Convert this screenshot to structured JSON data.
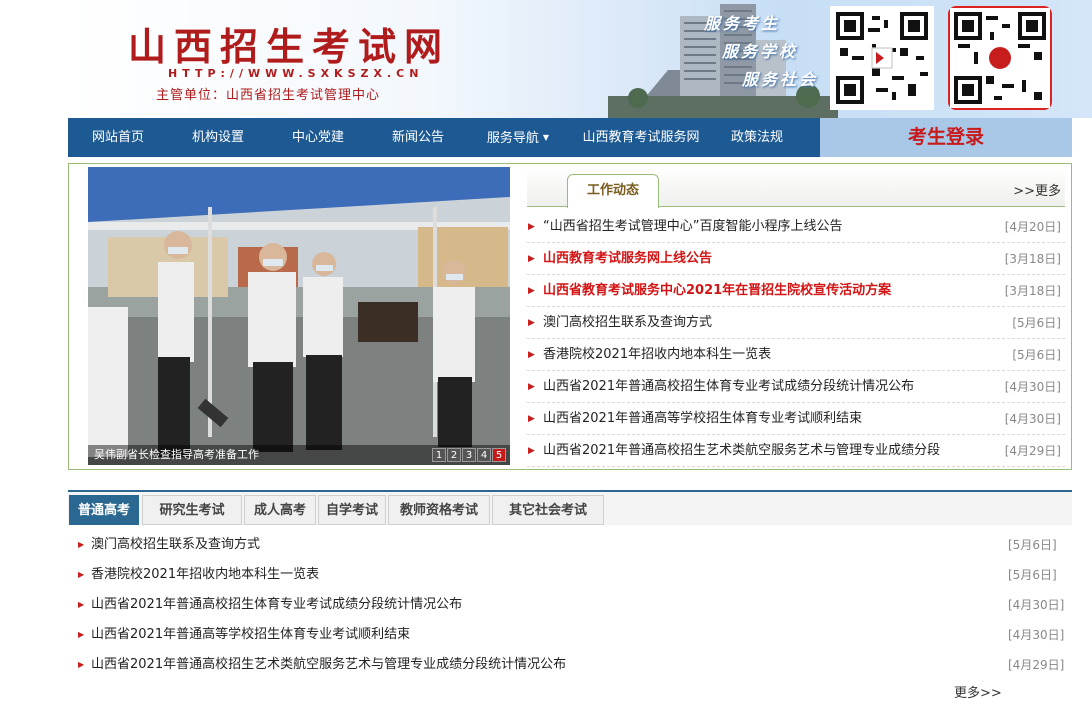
{
  "header": {
    "site_title": "山西招生考试网",
    "site_url": "HTTP://WWW.SXKSZX.CN",
    "dept": "主管单位：山西省招生考试管理中心",
    "slogans": [
      "服务考生",
      "服务学校",
      "服务社会"
    ]
  },
  "nav": {
    "items": [
      {
        "label": "网站首页"
      },
      {
        "label": "机构设置"
      },
      {
        "label": "中心党建"
      },
      {
        "label": "新闻公告"
      },
      {
        "label": "服务导航"
      },
      {
        "label": "山西教育考试服务网"
      },
      {
        "label": "政策法规"
      }
    ],
    "login": "考生登录"
  },
  "slideshow": {
    "caption": "吴伟副省长检查指导高考准备工作",
    "pages": [
      "1",
      "2",
      "3",
      "4",
      "5"
    ],
    "active_page": 5
  },
  "work_news": {
    "tab_label": "工作动态",
    "more": ">>更多",
    "items": [
      {
        "title": "“山西省招生考试管理中心”百度智能小程序上线公告",
        "date": "[4月20日]",
        "hot": false
      },
      {
        "title": "山西教育考试服务网上线公告",
        "date": "[3月18日]",
        "hot": true
      },
      {
        "title": "山西省教育考试服务中心2021年在晋招生院校宣传活动方案",
        "date": "[3月18日]",
        "hot": true
      },
      {
        "title": "澳门高校招生联系及查询方式",
        "date": "[5月6日]",
        "hot": false
      },
      {
        "title": "香港院校2021年招收内地本科生一览表",
        "date": "[5月6日]",
        "hot": false
      },
      {
        "title": "山西省2021年普通高校招生体育专业考试成绩分段统计情况公布",
        "date": "[4月30日]",
        "hot": false
      },
      {
        "title": "山西省2021年普通高等学校招生体育专业考试顺利结束",
        "date": "[4月30日]",
        "hot": false
      },
      {
        "title": "山西省2021年普通高校招生艺术类航空服务艺术与管理专业成绩分段",
        "date": "[4月29日]",
        "hot": false
      }
    ]
  },
  "exam_tabs": {
    "tabs": [
      "普通高考",
      "研究生考试",
      "成人高考",
      "自学考试",
      "教师资格考试",
      "其它社会考试"
    ],
    "active": 0,
    "items": [
      {
        "title": "澳门高校招生联系及查询方式",
        "date": "[5月6日]"
      },
      {
        "title": "香港院校2021年招收内地本科生一览表",
        "date": "[5月6日]"
      },
      {
        "title": "山西省2021年普通高校招生体育专业考试成绩分段统计情况公布",
        "date": "[4月30日]"
      },
      {
        "title": "山西省2021年普通高等学校招生体育专业考试顺利结束",
        "date": "[4月30日]"
      },
      {
        "title": "山西省2021年普通高校招生艺术类航空服务艺术与管理专业成绩分段统计情况公布",
        "date": "[4月29日]"
      }
    ],
    "more": "更多>>"
  },
  "colors": {
    "brand_red": "#b01c1c",
    "nav_blue": "#1d5a93",
    "tab_blue": "#2b6891",
    "frame_green": "#9bbb7a"
  },
  "icons": {
    "qr_codes": [
      "qr-code-icon",
      "qr-code-icon"
    ],
    "list_bullet": "triangle-right-icon",
    "dropdown": "caret-down-icon"
  }
}
